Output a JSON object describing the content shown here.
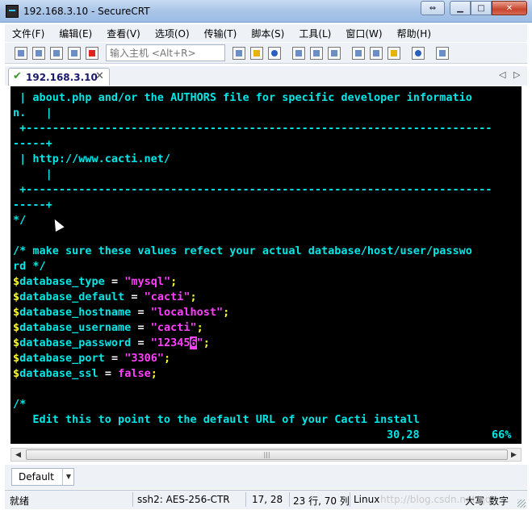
{
  "window": {
    "title": "192.168.3.10 - SecureCRT"
  },
  "menu": [
    "文件(F)",
    "编辑(E)",
    "查看(V)",
    "选项(O)",
    "传输(T)",
    "脚本(S)",
    "工具(L)",
    "窗口(W)",
    "帮助(H)"
  ],
  "toolbar": {
    "host_placeholder": "输入主机 <Alt+R>"
  },
  "tab": {
    "label": "192.168.3.10"
  },
  "terminal": {
    "lines": [
      [
        {
          "t": " | about.php and/or the AUTHORS file for specific developer informatio",
          "c": "c-cyan"
        }
      ],
      [
        {
          "t": "n.   |",
          "c": "c-cyan"
        }
      ],
      [
        {
          "t": " +-----------------------------------------------------------------------",
          "c": "c-cyan"
        }
      ],
      [
        {
          "t": "-----+",
          "c": "c-cyan"
        }
      ],
      [
        {
          "t": " | http://www.cacti.net/",
          "c": "c-cyan"
        }
      ],
      [
        {
          "t": "     |",
          "c": "c-cyan"
        }
      ],
      [
        {
          "t": " +-----------------------------------------------------------------------",
          "c": "c-cyan"
        }
      ],
      [
        {
          "t": "-----+",
          "c": "c-cyan"
        }
      ],
      [
        {
          "t": "*/",
          "c": "c-cyan"
        }
      ],
      [
        {
          "t": "",
          "c": "c-cyan"
        }
      ],
      [
        {
          "t": "/* make sure these values refect your actual database/host/user/passwo",
          "c": "c-cyan"
        }
      ],
      [
        {
          "t": "rd */",
          "c": "c-cyan"
        }
      ],
      [
        {
          "t": "$",
          "c": "c-yellow"
        },
        {
          "t": "database_type",
          "c": "c-cyan"
        },
        {
          "t": " = ",
          "c": "c-white"
        },
        {
          "t": "\"",
          "c": "c-magenta"
        },
        {
          "t": "mysql",
          "c": "c-magenta"
        },
        {
          "t": "\"",
          "c": "c-magenta"
        },
        {
          "t": ";",
          "c": "c-yellow"
        }
      ],
      [
        {
          "t": "$",
          "c": "c-yellow"
        },
        {
          "t": "database_default",
          "c": "c-cyan"
        },
        {
          "t": " = ",
          "c": "c-white"
        },
        {
          "t": "\"cacti\"",
          "c": "c-magenta"
        },
        {
          "t": ";",
          "c": "c-yellow"
        }
      ],
      [
        {
          "t": "$",
          "c": "c-yellow"
        },
        {
          "t": "database_hostname",
          "c": "c-cyan"
        },
        {
          "t": " = ",
          "c": "c-white"
        },
        {
          "t": "\"localhost\"",
          "c": "c-magenta"
        },
        {
          "t": ";",
          "c": "c-yellow"
        }
      ],
      [
        {
          "t": "$",
          "c": "c-yellow"
        },
        {
          "t": "database_username",
          "c": "c-cyan"
        },
        {
          "t": " = ",
          "c": "c-white"
        },
        {
          "t": "\"cacti\"",
          "c": "c-magenta"
        },
        {
          "t": ";",
          "c": "c-yellow"
        }
      ],
      [
        {
          "t": "$",
          "c": "c-yellow"
        },
        {
          "t": "database_password",
          "c": "c-cyan"
        },
        {
          "t": " = ",
          "c": "c-white"
        },
        {
          "t": "\"12345",
          "c": "c-magenta"
        },
        {
          "t": "6",
          "c": "cursor"
        },
        {
          "t": "\"",
          "c": "c-magenta"
        },
        {
          "t": ";",
          "c": "c-yellow"
        }
      ],
      [
        {
          "t": "$",
          "c": "c-yellow"
        },
        {
          "t": "database_port",
          "c": "c-cyan"
        },
        {
          "t": " = ",
          "c": "c-white"
        },
        {
          "t": "\"3306\"",
          "c": "c-magenta"
        },
        {
          "t": ";",
          "c": "c-yellow"
        }
      ],
      [
        {
          "t": "$",
          "c": "c-yellow"
        },
        {
          "t": "database_ssl",
          "c": "c-cyan"
        },
        {
          "t": " = ",
          "c": "c-white"
        },
        {
          "t": "false",
          "c": "c-magenta"
        },
        {
          "t": ";",
          "c": "c-yellow"
        }
      ],
      [
        {
          "t": "",
          "c": "c-cyan"
        }
      ],
      [
        {
          "t": "/*",
          "c": "c-cyan"
        }
      ],
      [
        {
          "t": "   Edit this to point to the default URL of your Cacti install",
          "c": "c-cyan"
        }
      ]
    ],
    "ruler_position": "30,28",
    "ruler_percent": "66%"
  },
  "session_button": {
    "label": "Default"
  },
  "status": {
    "ready": "就绪",
    "connection": "ssh2: AES-256-CTR",
    "cursor": "17,  28",
    "size": "23 行, 70 列",
    "os": "Linux",
    "watermark": "http://blog.csdn.net/qq_",
    "caps": "大写",
    "num": "数字"
  }
}
